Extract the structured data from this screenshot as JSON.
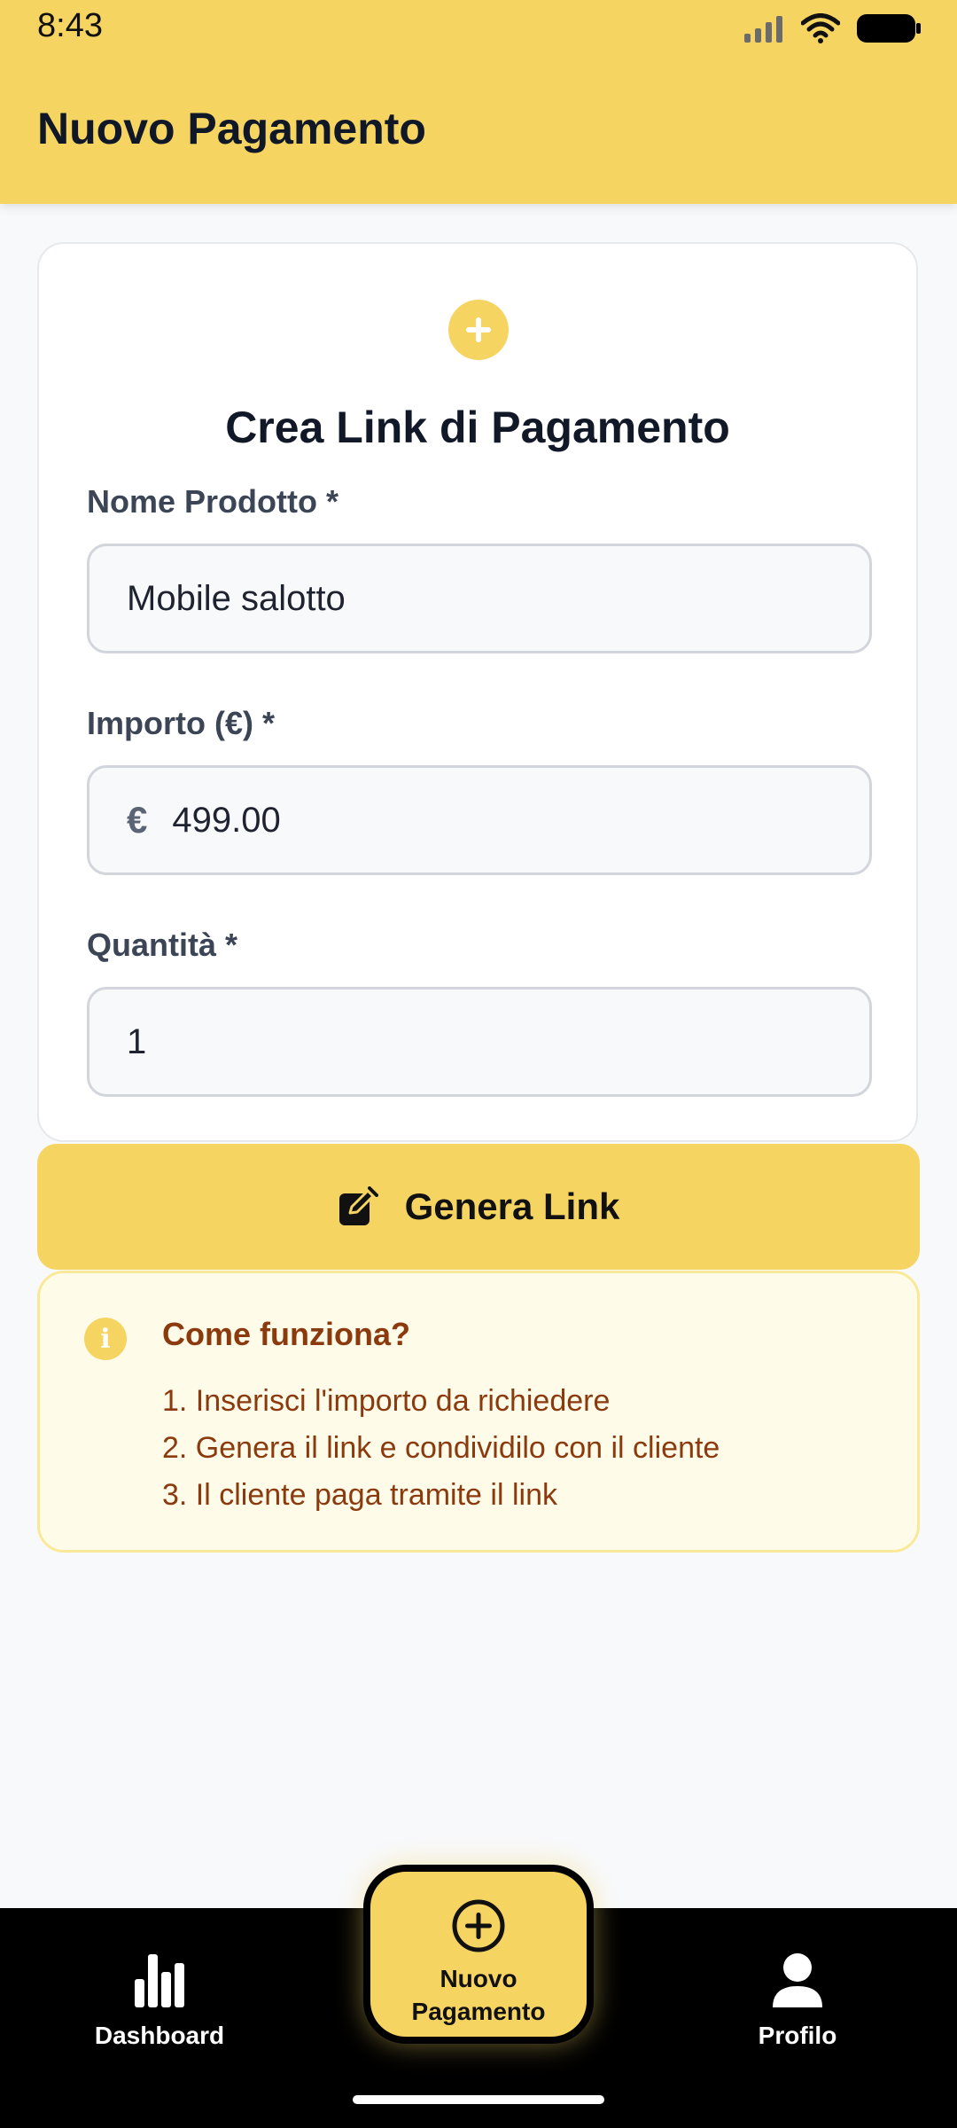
{
  "status_bar": {
    "time": "8:43",
    "icons": [
      "signal-icon",
      "wifi-icon",
      "battery-icon"
    ]
  },
  "header": {
    "title": "Nuovo Pagamento"
  },
  "form": {
    "icon": "plus-icon",
    "title": "Crea Link di Pagamento",
    "product_name": {
      "label": "Nome Prodotto *",
      "value": "Mobile salotto"
    },
    "amount": {
      "label": "Importo (€) *",
      "prefix": "€",
      "value": "499.00"
    },
    "quantity": {
      "label": "Quantità *",
      "value": "1"
    },
    "submit": {
      "label": "Genera Link",
      "icon": "edit-icon"
    }
  },
  "info": {
    "icon": "info-icon",
    "title": "Come funziona?",
    "steps": [
      "1. Inserisci l'importo da richiedere",
      "2. Genera il link e condividilo con il cliente",
      "3. Il cliente paga tramite il link"
    ]
  },
  "bottom_nav": {
    "dashboard": {
      "label": "Dashboard",
      "icon": "bar-chart-icon"
    },
    "new_payment": {
      "label": "Nuovo Pagamento",
      "icon": "plus-circle-icon"
    },
    "profile": {
      "label": "Profilo",
      "icon": "user-icon"
    }
  },
  "colors": {
    "accent": "#f5d461",
    "info_text": "#8b3a0e",
    "info_bg": "#fefbe9",
    "nav_bg": "#000000"
  }
}
